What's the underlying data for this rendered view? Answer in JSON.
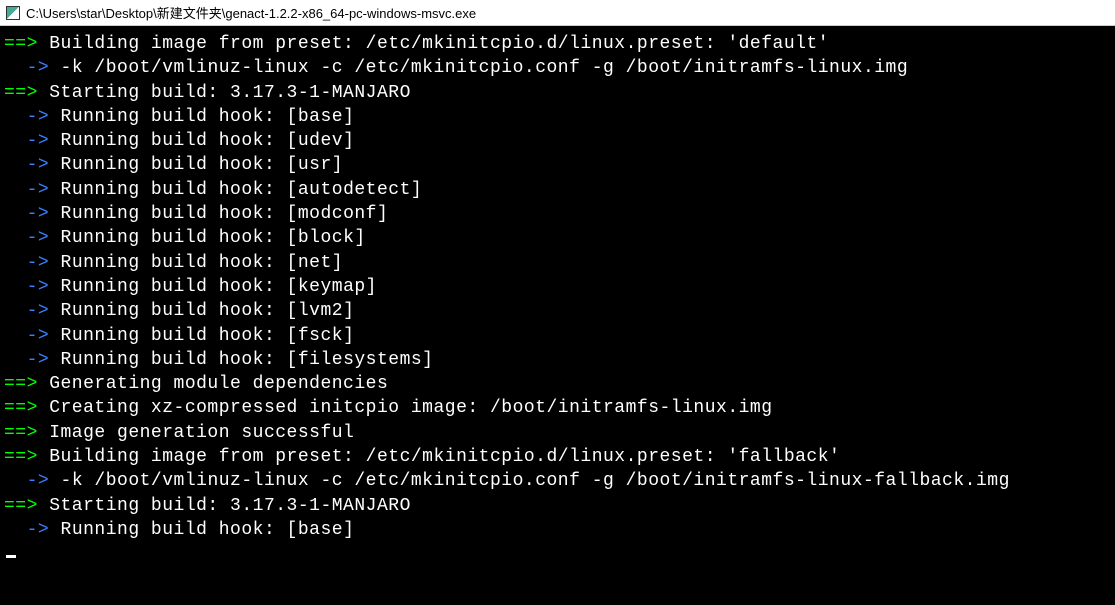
{
  "window": {
    "title": "C:\\Users\\star\\Desktop\\新建文件夹\\genact-1.2.2-x86_64-pc-windows-msvc.exe"
  },
  "terminal": {
    "arrow_main": "==>",
    "arrow_sub": "  ->",
    "lines": [
      {
        "prefix": "main",
        "text": " Building image from preset: /etc/mkinitcpio.d/linux.preset: 'default'"
      },
      {
        "prefix": "sub",
        "text": " -k /boot/vmlinuz-linux -c /etc/mkinitcpio.conf -g /boot/initramfs-linux.img"
      },
      {
        "prefix": "main",
        "text": " Starting build: 3.17.3-1-MANJARO"
      },
      {
        "prefix": "sub",
        "text": " Running build hook: [base]"
      },
      {
        "prefix": "sub",
        "text": " Running build hook: [udev]"
      },
      {
        "prefix": "sub",
        "text": " Running build hook: [usr]"
      },
      {
        "prefix": "sub",
        "text": " Running build hook: [autodetect]"
      },
      {
        "prefix": "sub",
        "text": " Running build hook: [modconf]"
      },
      {
        "prefix": "sub",
        "text": " Running build hook: [block]"
      },
      {
        "prefix": "sub",
        "text": " Running build hook: [net]"
      },
      {
        "prefix": "sub",
        "text": " Running build hook: [keymap]"
      },
      {
        "prefix": "sub",
        "text": " Running build hook: [lvm2]"
      },
      {
        "prefix": "sub",
        "text": " Running build hook: [fsck]"
      },
      {
        "prefix": "sub",
        "text": " Running build hook: [filesystems]"
      },
      {
        "prefix": "main",
        "text": " Generating module dependencies"
      },
      {
        "prefix": "main",
        "text": " Creating xz-compressed initcpio image: /boot/initramfs-linux.img"
      },
      {
        "prefix": "main",
        "text": " Image generation successful"
      },
      {
        "prefix": "main",
        "text": " Building image from preset: /etc/mkinitcpio.d/linux.preset: 'fallback'"
      },
      {
        "prefix": "sub",
        "text": " -k /boot/vmlinuz-linux -c /etc/mkinitcpio.conf -g /boot/initramfs-linux-fallback.img"
      },
      {
        "prefix": "main",
        "text": " Starting build: 3.17.3-1-MANJARO"
      },
      {
        "prefix": "sub",
        "text": " Running build hook: [base]"
      }
    ]
  }
}
